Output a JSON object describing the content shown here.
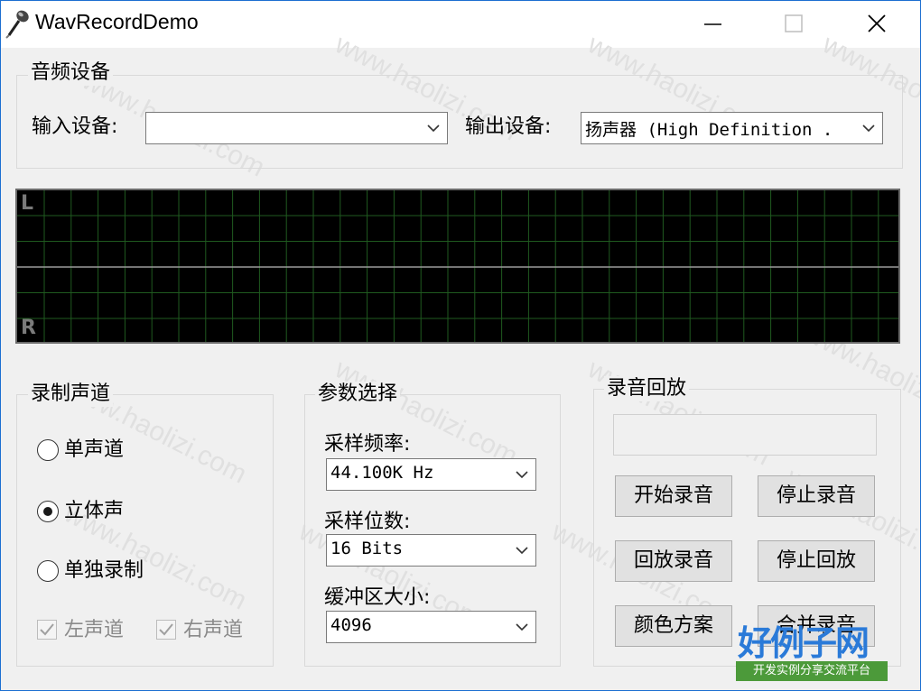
{
  "window": {
    "title": "WavRecordDemo"
  },
  "audio_devices": {
    "group_title": "音频设备",
    "input_label": "输入设备:",
    "input_value": "",
    "output_label": "输出设备:",
    "output_value": "扬声器 (High Definition ."
  },
  "scope": {
    "left_label": "L",
    "right_label": "R"
  },
  "channels": {
    "group_title": "录制声道",
    "options": [
      {
        "label": "单声道",
        "selected": false
      },
      {
        "label": "立体声",
        "selected": true
      },
      {
        "label": "单独录制",
        "selected": false
      }
    ],
    "left_channel": {
      "label": "左声道",
      "checked": true,
      "enabled": false
    },
    "right_channel": {
      "label": "右声道",
      "checked": true,
      "enabled": false
    }
  },
  "params": {
    "group_title": "参数选择",
    "sample_rate_label": "采样频率:",
    "sample_rate_value": "44.100K Hz",
    "bits_label": "采样位数:",
    "bits_value": "16 Bits",
    "buffer_label": "缓冲区大小:",
    "buffer_value": "4096"
  },
  "playback": {
    "group_title": "录音回放",
    "display_value": "",
    "buttons": {
      "start_record": "开始录音",
      "stop_record": "停止录音",
      "play_record": "回放录音",
      "stop_play": "停止回放",
      "color_scheme": "颜色方案",
      "merge_record": "合并录音"
    }
  },
  "watermark": {
    "text": "www.haolizi.com",
    "logo_main": "好例子网",
    "logo_sub": "开发实例分享交流平台"
  },
  "colors": {
    "scope_bg": "#000000",
    "scope_grid": "#1f5a1f",
    "scope_center": "#9a9a9a",
    "logo_blue": "#2a7ad8",
    "logo_green": "#4c9a3a"
  }
}
